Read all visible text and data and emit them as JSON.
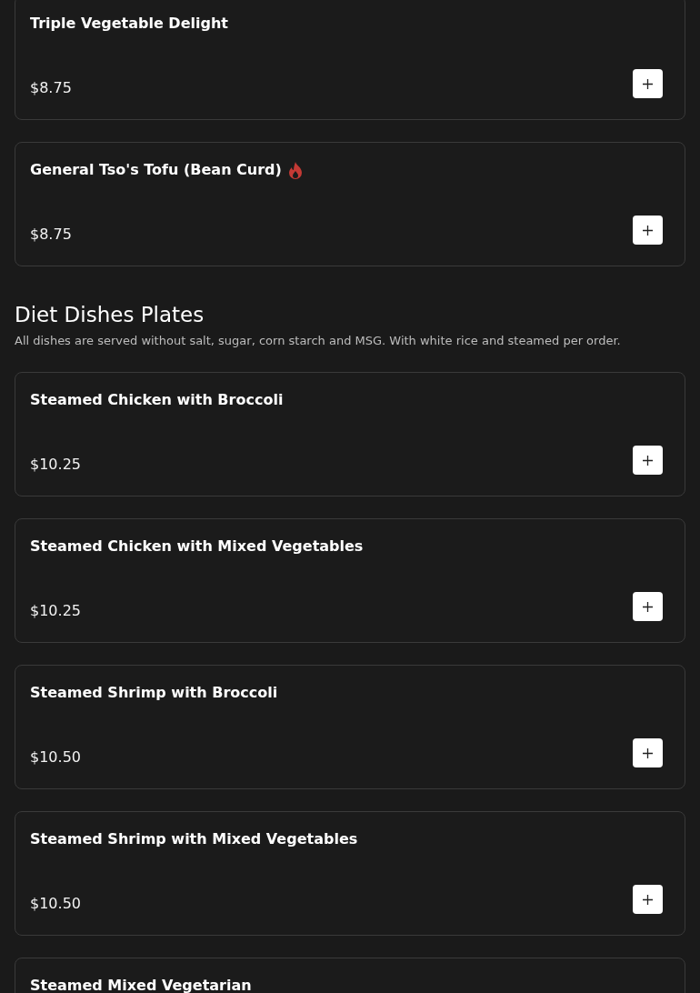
{
  "sections": [
    {
      "items": [
        {
          "name": "Triple Vegetable Delight",
          "price": "$8.75",
          "spicy": false
        },
        {
          "name": "General Tso's Tofu (Bean Curd)",
          "price": "$8.75",
          "spicy": true
        }
      ]
    },
    {
      "title": "Diet Dishes Plates",
      "description": "All dishes are served without salt, sugar, corn starch and MSG. With white rice and steamed per order.",
      "items": [
        {
          "name": "Steamed Chicken with Broccoli",
          "price": "$10.25",
          "spicy": false
        },
        {
          "name": "Steamed Chicken with Mixed Vegetables",
          "price": "$10.25",
          "spicy": false
        },
        {
          "name": "Steamed Shrimp with Broccoli",
          "price": "$10.50",
          "spicy": false
        },
        {
          "name": "Steamed Shrimp with Mixed Vegetables",
          "price": "$10.50",
          "spicy": false
        },
        {
          "name": "Steamed Mixed Vegetarian",
          "spicy": false
        }
      ]
    }
  ]
}
